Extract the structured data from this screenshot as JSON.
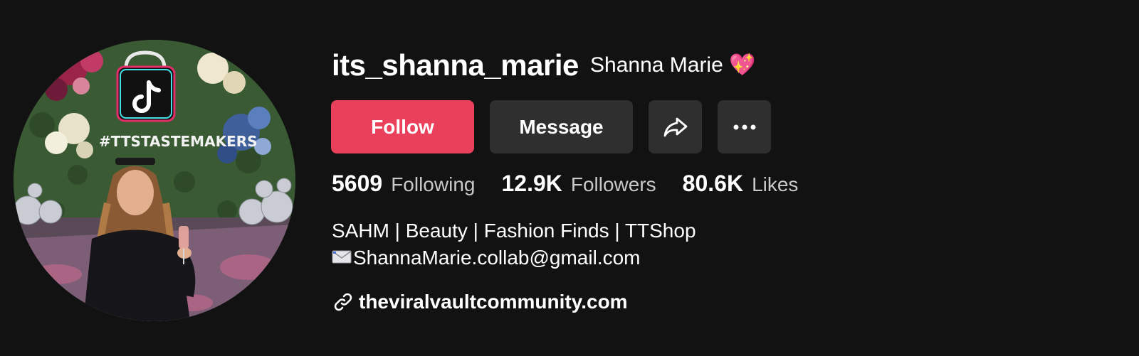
{
  "profile": {
    "username": "its_shanna_marie",
    "display_name": "Shanna Marie",
    "display_name_emoji": "💖",
    "avatar_text": "#TTSTASTEMAKERS"
  },
  "actions": {
    "follow_label": "Follow",
    "message_label": "Message",
    "share_icon": "share-arrow-icon",
    "more_icon": "more-dots-icon"
  },
  "stats": [
    {
      "value": "5609",
      "label": "Following"
    },
    {
      "value": "12.9K",
      "label": "Followers"
    },
    {
      "value": "80.6K",
      "label": "Likes"
    }
  ],
  "bio": {
    "line1": "SAHM | Beauty | Fashion Finds | TTShop",
    "line2": "ShannaMarie.collab@gmail.com",
    "line2_icon": "envelope-icon"
  },
  "link": {
    "icon": "link-icon",
    "text": "theviralvaultcommunity.com"
  },
  "colors": {
    "background": "#121212",
    "follow": "#ea405b",
    "secondary_button": "#2f2f2f",
    "muted_text": "#c9c9c9"
  }
}
